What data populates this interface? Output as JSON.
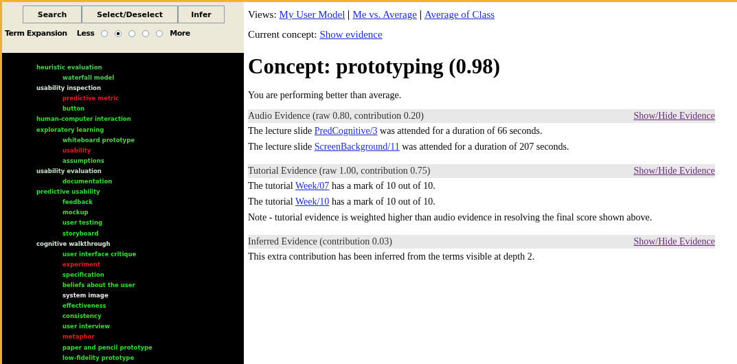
{
  "toolbar": {
    "buttons": [
      "Search",
      "Select/Deselect",
      "Infer"
    ]
  },
  "term_expansion": {
    "label": "Term Expansion",
    "low": "Less",
    "high": "More",
    "options": [
      {
        "selected": false
      },
      {
        "selected": true
      },
      {
        "selected": false
      },
      {
        "selected": false
      },
      {
        "selected": false
      }
    ]
  },
  "terms": [
    {
      "text": "heuristic evaluation",
      "color": "#4fd04f",
      "children": [
        {
          "text": "waterfall model",
          "color": "#4fd04f"
        }
      ]
    },
    {
      "text": "usability inspection",
      "color": "#d8e8d8",
      "children": [
        {
          "text": "predictive metric",
          "color": "#e02020"
        },
        {
          "text": "button",
          "color": "#30e030"
        }
      ]
    },
    {
      "text": "human-computer interaction",
      "color": "#30e030"
    },
    {
      "text": "exploratory learning",
      "color": "#30e030",
      "children": [
        {
          "text": "whiteboard prototype",
          "color": "#4fd04f"
        },
        {
          "text": "usability",
          "color": "#e02020"
        },
        {
          "text": "assumptions",
          "color": "#4fd04f"
        }
      ]
    },
    {
      "text": "usability evaluation",
      "color": "#c8e0c8",
      "children": [
        {
          "text": "documentation",
          "color": "#30e030"
        }
      ]
    },
    {
      "text": "predictive usability",
      "color": "#30e030",
      "children": [
        {
          "text": "feedback",
          "color": "#30e030"
        },
        {
          "text": "mockup",
          "color": "#4fd04f"
        },
        {
          "text": "user testing",
          "color": "#30e030"
        },
        {
          "text": "storyboard",
          "color": "#30e030"
        }
      ]
    },
    {
      "text": "cognitive walkthrough",
      "color": "#d8e8d8",
      "children": [
        {
          "text": "user interface critique",
          "color": "#30e030"
        },
        {
          "text": "experiment",
          "color": "#e02020"
        },
        {
          "text": "specification",
          "color": "#30e030"
        },
        {
          "text": "beliefs about the user",
          "color": "#30e030"
        },
        {
          "text": "system image",
          "color": "#e8e8e8"
        },
        {
          "text": "effectiveness",
          "color": "#30e030"
        },
        {
          "text": "consistency",
          "color": "#30e030"
        },
        {
          "text": "user interview",
          "color": "#30e030"
        },
        {
          "text": "metaphor",
          "color": "#e02020"
        },
        {
          "text": "paper and pencil prototype",
          "color": "#30e030"
        },
        {
          "text": "low-fidelity prototype",
          "color": "#30e030"
        }
      ]
    }
  ],
  "views": {
    "label": "Views:",
    "links": [
      "My User Model",
      "Me vs. Average",
      "Average of Class"
    ]
  },
  "current_concept": {
    "label": "Current concept:",
    "link": "Show evidence"
  },
  "title": "Concept: prototyping (0.98)",
  "summary": "You are performing better than average.",
  "sections": [
    {
      "header": "Audio Evidence (raw 0.80, contribution 0.20)",
      "toggle": "Show/Hide Evidence",
      "lines": [
        {
          "before": "The lecture slide ",
          "link": "PredCognitive/3",
          "after": " was attended for a duration of 66 seconds."
        },
        {
          "before": "The lecture slide ",
          "link": "ScreenBackground/11",
          "after": " was attended for a duration of 207 seconds."
        }
      ]
    },
    {
      "header": "Tutorial Evidence (raw 1.00, contribution 0.75)",
      "toggle": "Show/Hide Evidence",
      "lines": [
        {
          "before": "The tutorial ",
          "link": "Week/07",
          "after": " has a mark of 10 out of 10."
        },
        {
          "before": "The tutorial ",
          "link": "Week/10",
          "after": " has a mark of 10 out of 10."
        },
        {
          "before": "Note - tutorial evidence is weighted higher than audio evidence in resolving the final score shown above."
        }
      ]
    },
    {
      "header": "Inferred Evidence (contribution 0.03)",
      "toggle": "Show/Hide Evidence",
      "lines": [
        {
          "before": "This extra contribution has been inferred from the terms visible at depth 2."
        }
      ]
    }
  ]
}
